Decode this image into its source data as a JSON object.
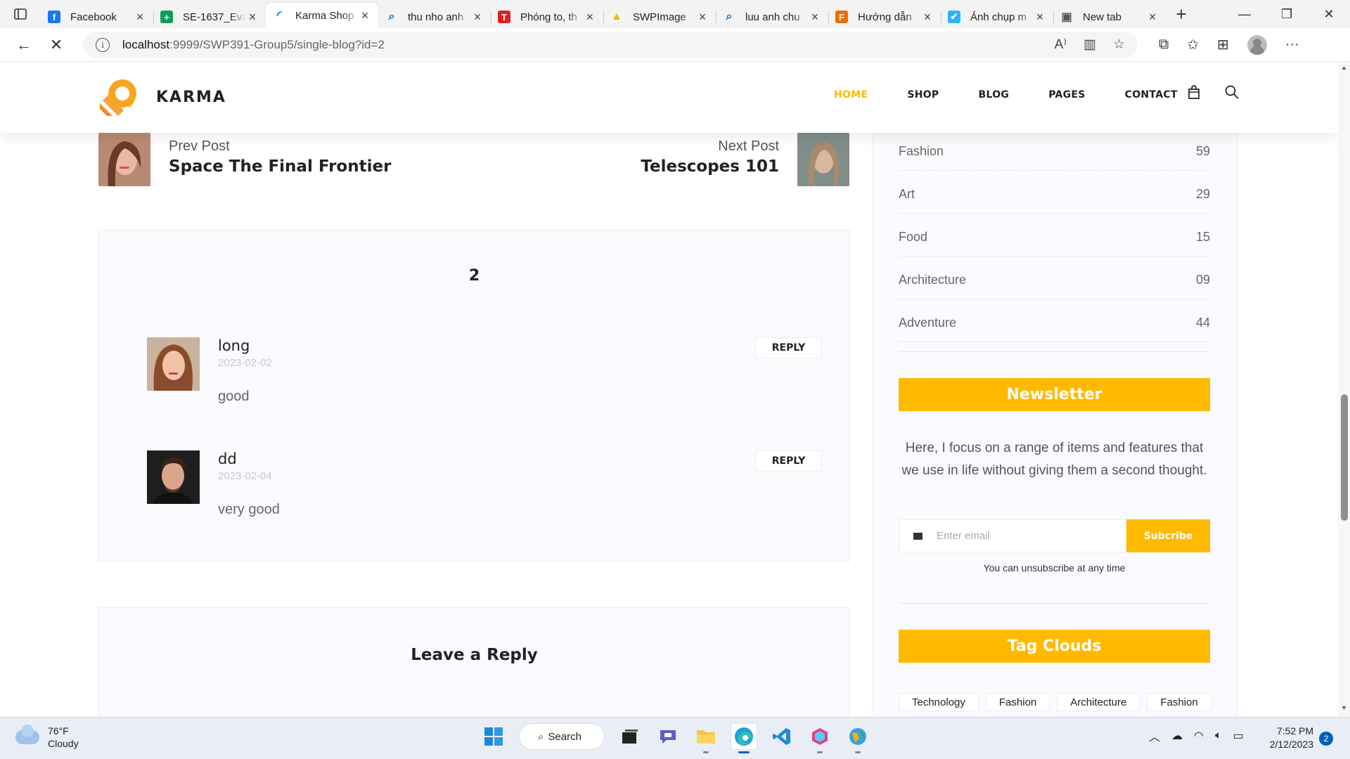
{
  "browser": {
    "tabs": [
      {
        "title": "Facebook",
        "favicon": "facebook-icon",
        "color": "#1877f2",
        "glyph": "f"
      },
      {
        "title": "SE-1637_Eva",
        "favicon": "sheets-icon",
        "color": "#0f9d58",
        "glyph": "+"
      },
      {
        "title": "Karma Shop",
        "favicon": "loading-icon",
        "color": "#0067c0",
        "glyph": "◜"
      },
      {
        "title": "thu nho anh",
        "favicon": "search-icon",
        "color": "#0067c0",
        "glyph": "⌕"
      },
      {
        "title": "Phóng to, th",
        "favicon": "t-brand-icon",
        "color": "#e02020",
        "glyph": "T"
      },
      {
        "title": "SWPImage",
        "favicon": "drive-icon",
        "color": "#f4b400",
        "glyph": "▲"
      },
      {
        "title": "luu anh chu",
        "favicon": "search-icon",
        "color": "#0067c0",
        "glyph": "⌕"
      },
      {
        "title": "Hướng dẫn",
        "favicon": "fpt-icon",
        "color": "#ef6c00",
        "glyph": "F"
      },
      {
        "title": "Ảnh chụp m",
        "favicon": "bird-icon",
        "color": "#29b6f6",
        "glyph": "✔"
      },
      {
        "title": "New tab",
        "favicon": "newtab-icon",
        "color": "#555555",
        "glyph": "▣"
      }
    ],
    "active_tab_index": 2,
    "url_host": "localhost",
    "url_path": ":9999/SWP391-Group5/single-blog?id=2"
  },
  "site": {
    "logo_text": "KARMA",
    "accent_color": "#ffba00",
    "nav": [
      "HOME",
      "SHOP",
      "BLOG",
      "PAGES",
      "CONTACT"
    ],
    "nav_active": "HOME"
  },
  "prev_next": {
    "prev_label": "Prev Post",
    "prev_title": "Space The Final Frontier",
    "next_label": "Next Post",
    "next_title": "Telescopes 101"
  },
  "comments": {
    "count": "2",
    "reply_label": "REPLY",
    "items": [
      {
        "name": "long",
        "date": "2023-02-02",
        "text": "good"
      },
      {
        "name": "dd",
        "date": "2023-02-04",
        "text": "very good"
      }
    ]
  },
  "reply_form": {
    "heading": "Leave a Reply"
  },
  "sidebar": {
    "categories": [
      {
        "name": "Fashion",
        "count": "59"
      },
      {
        "name": "Art",
        "count": "29"
      },
      {
        "name": "Food",
        "count": "15"
      },
      {
        "name": "Architecture",
        "count": "09"
      },
      {
        "name": "Adventure",
        "count": "44"
      }
    ],
    "newsletter": {
      "title": "Newsletter",
      "text": "Here, I focus on a range of items and features that we use in life without giving them a second thought.",
      "placeholder": "Enter email",
      "button": "Subcribe",
      "note": "You can unsubscribe at any time"
    },
    "tag_clouds": {
      "title": "Tag Clouds",
      "tags": [
        "Technology",
        "Fashion",
        "Architecture",
        "Fashion"
      ]
    }
  },
  "taskbar": {
    "temperature": "76°F",
    "condition": "Cloudy",
    "search_label": "Search",
    "time": "7:52 PM",
    "date": "2/12/2023",
    "notifications": "2"
  }
}
